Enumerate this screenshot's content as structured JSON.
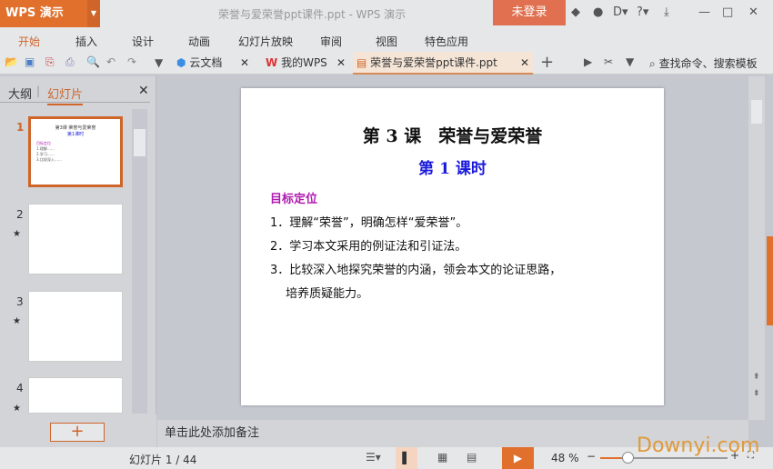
{
  "app": {
    "logo": "WPS 演示",
    "title": "荣誉与爱荣誉ppt课件.ppt - WPS 演示",
    "login": "未登录"
  },
  "menu": [
    "开始",
    "插入",
    "设计",
    "动画",
    "幻灯片放映",
    "审阅",
    "视图",
    "特色应用"
  ],
  "tabs": [
    {
      "label": "云文档"
    },
    {
      "label": "我的WPS"
    },
    {
      "label": "荣誉与爱荣誉ppt课件.ppt"
    }
  ],
  "search": "查找命令、搜索模板",
  "panel": {
    "tab_outline": "大纲",
    "tab_slides": "幻灯片",
    "slides": [
      "1",
      "2",
      "3",
      "4"
    ]
  },
  "slide": {
    "title": "第 3 课　荣誉与爱荣誉",
    "subtitle": "第 1 课时",
    "section": "目标定位",
    "items": [
      "1．理解“荣誉”，明确怎样“爱荣誉”。",
      "2．学习本文采用的例证法和引证法。",
      "3．比较深入地探究荣誉的内涵，领会本文的论证思路，",
      "　 培养质疑能力。"
    ]
  },
  "notes": "单击此处添加备注",
  "status": {
    "slide_count": "幻灯片 1 / 44",
    "zoom": "48 %",
    "zoom_level": 48
  },
  "watermark": "Downyi.com",
  "colors": {
    "accent": "#e0702c",
    "title_blue": "#1a1adc",
    "section_purple": "#b01ab0"
  }
}
